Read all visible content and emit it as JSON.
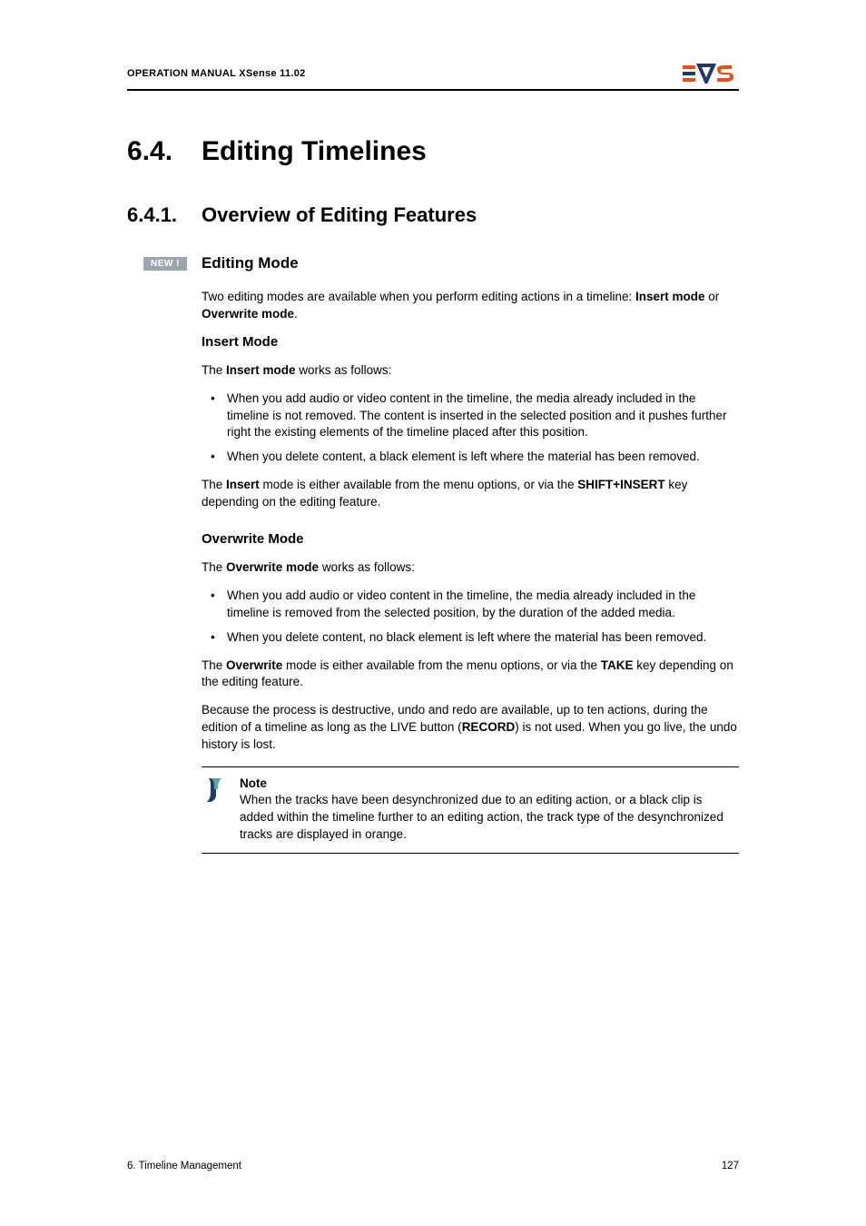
{
  "header": {
    "manual": "OPERATION MANUAL XSense 11.02"
  },
  "h1": {
    "num": "6.4.",
    "title": "Editing Timelines"
  },
  "h2": {
    "num": "6.4.1.",
    "title": "Overview of Editing Features"
  },
  "badge": "NEW !",
  "h3": "Editing Mode",
  "intro_pre": "Two editing modes are available when you perform editing actions in a timeline: ",
  "intro_b1": "Insert mode",
  "intro_mid": " or ",
  "intro_b2": "Overwrite mode",
  "intro_post": ".",
  "insert": {
    "heading": "Insert Mode",
    "lead_pre": "The ",
    "lead_b": "Insert mode",
    "lead_post": " works as follows:",
    "li1": "When you add audio or video content in the timeline, the media already included in the timeline is not removed. The content is inserted in the selected position and it pushes further right the existing elements of the timeline placed after this position.",
    "li2": "When you delete content, a black element is left where the material has been removed.",
    "tail_pre": "The ",
    "tail_b1": "Insert",
    "tail_mid": " mode is either available from the menu options, or via the ",
    "tail_b2": "SHIFT+INSERT",
    "tail_post": " key depending on the editing feature."
  },
  "overwrite": {
    "heading": "Overwrite Mode",
    "lead_pre": "The ",
    "lead_b": "Overwrite mode",
    "lead_post": " works as follows:",
    "li1": "When you add audio or video content in the timeline, the media already included in the timeline is removed from the selected position, by the duration of the added media.",
    "li2": "When you delete content, no black element is left where the material has been removed.",
    "tail_pre": "The ",
    "tail_b1": "Overwrite",
    "tail_mid": " mode is either available from the menu options, or via the ",
    "tail_b2": "TAKE",
    "tail_post": " key depending on the editing feature.",
    "undo_pre": "Because the process is destructive, undo and redo are available, up to ten actions, during the edition of a timeline as long as the LIVE button (",
    "undo_b": "RECORD",
    "undo_post": ") is not used. When you go live, the undo history is lost."
  },
  "note": {
    "title": "Note",
    "text": "When the tracks have been desynchronized due to an editing action, or a black clip is added within the timeline further to an editing action, the track type of the desynchronized tracks are displayed in orange."
  },
  "footer": {
    "left": "6. Timeline Management",
    "right": "127"
  }
}
